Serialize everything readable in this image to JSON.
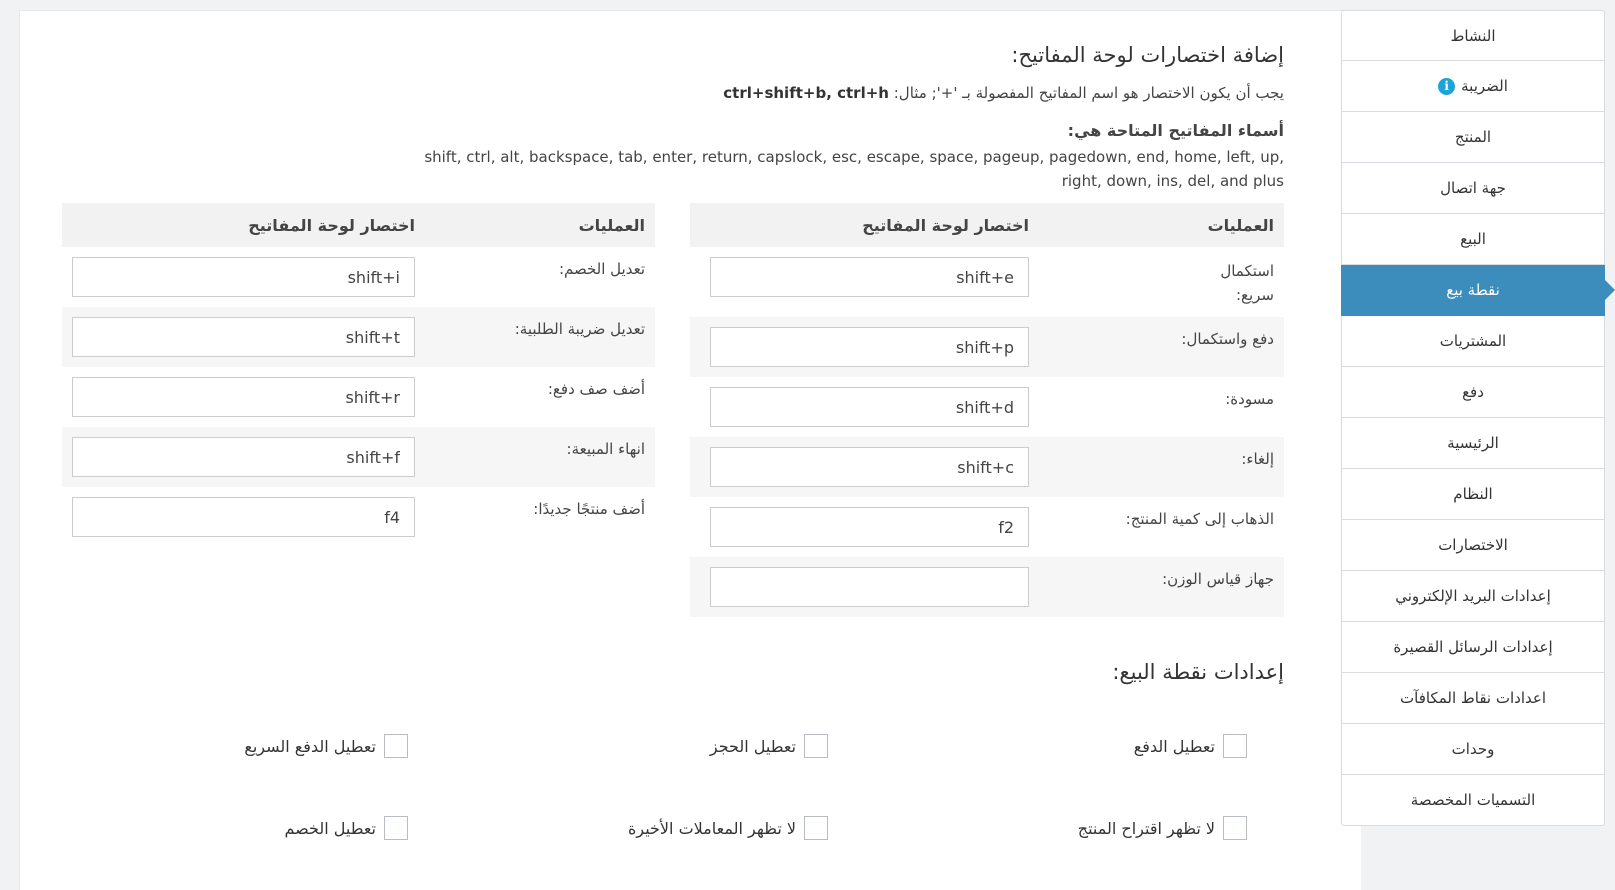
{
  "sidebar": {
    "items": [
      {
        "label": "النشاط"
      },
      {
        "label": "الضريبة"
      },
      {
        "label": "المنتج"
      },
      {
        "label": "جهة اتصال"
      },
      {
        "label": "البيع"
      },
      {
        "label": "نقطة بيع"
      },
      {
        "label": "المشتريات"
      },
      {
        "label": "دفع"
      },
      {
        "label": "الرئيسية"
      },
      {
        "label": "النظام"
      },
      {
        "label": "الاختصارات"
      },
      {
        "label": "إعدادات البريد الإلكتروني"
      },
      {
        "label": "إعدادات الرسائل القصيرة"
      },
      {
        "label": "اعدادات نقاط المكافآت"
      },
      {
        "label": "وحدات"
      },
      {
        "label": "التسميات المخصصة"
      }
    ],
    "active_index": 5,
    "info_icon": "i"
  },
  "shortcuts": {
    "title": "إضافة اختصارات لوحة المفاتيح:",
    "hint_text": "يجب أن يكون الاختصار هو اسم المفاتيح المفصولة بـ '+'; مثال: ",
    "hint_example": "ctrl+shift+b, ctrl+h",
    "available_label": "أسماء المفاتيح المتاحة هي:",
    "available_keys": "shift, ctrl, alt, backspace, tab, enter, return, capslock, esc, escape, space, pageup, pagedown, end, home, left, up, right, down, ins, del, and plus"
  },
  "table_headers": {
    "operations": "العمليات",
    "keyboard_shortcut": "اختصار لوحة المفاتيح"
  },
  "right_table": [
    {
      "label": "استكمال سريع:",
      "value": "shift+e"
    },
    {
      "label": "دفع واستكمال:",
      "value": "shift+p"
    },
    {
      "label": "مسودة:",
      "value": "shift+d"
    },
    {
      "label": "إلغاء:",
      "value": "shift+c"
    },
    {
      "label": "الذهاب إلى كمية المنتج:",
      "value": "f2"
    },
    {
      "label": "جهاز قياس الوزن:",
      "value": ""
    }
  ],
  "left_table": [
    {
      "label": "تعديل الخصم:",
      "value": "shift+i"
    },
    {
      "label": "تعديل ضريبة الطلبية:",
      "value": "shift+t"
    },
    {
      "label": "أضف صف دفع:",
      "value": "shift+r"
    },
    {
      "label": "انهاء المبيعة:",
      "value": "shift+f"
    },
    {
      "label": "أضف منتجًا جديدًا:",
      "value": "f4"
    }
  ],
  "pos_settings": {
    "title": "إعدادات نقطة البيع:",
    "checkboxes": [
      {
        "label": "تعطيل الدفع",
        "checked": false
      },
      {
        "label": "تعطيل الحجز",
        "checked": false
      },
      {
        "label": "تعطيل الدفع السريع",
        "checked": false
      },
      {
        "label": "لا تظهر اقتراح المنتج",
        "checked": false
      },
      {
        "label": "لا تظهر المعاملات الأخيرة",
        "checked": false
      },
      {
        "label": "تعطيل الخصم",
        "checked": false
      }
    ]
  }
}
